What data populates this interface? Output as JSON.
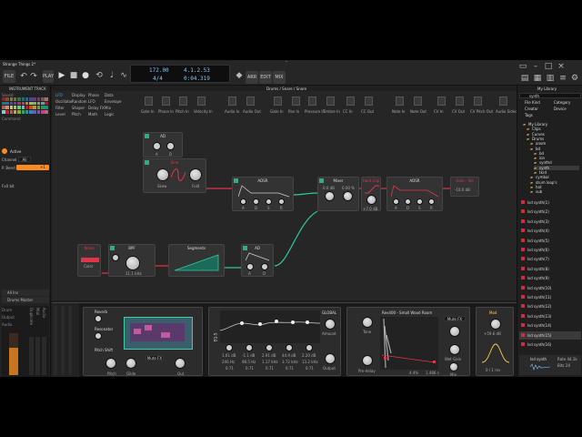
{
  "app": {
    "project_tab": "Strange Things 2*",
    "menu_label": "FILE",
    "play_label": "PLAY",
    "tempo": "172.00",
    "time_sig": "4/4",
    "position": "4.1.2.53",
    "time": "0:04.319",
    "mode_buttons": [
      "ARR",
      "EDIT",
      "MIX"
    ]
  },
  "left_panel": {
    "title": "INSTRUMENT TRACK",
    "section_sound": "Sound",
    "section_command": "Command",
    "active_label": "Active",
    "channel_label": "Channel",
    "channel_value": "All",
    "pbend_label": "P. Bend",
    "pbend_value": "+1",
    "fxslot_label": "Fx0 bit",
    "all_ins_label": "All Ins",
    "master_label": "Drums Master",
    "meter_labels": [
      "Drum",
      "Output",
      "Audio",
      "Duplicate",
      "Midi",
      "Audio"
    ]
  },
  "breadcrumb": "Drums / Snare / Snare",
  "palette": {
    "row1": [
      "LFO",
      "Display",
      "Phase",
      "Data"
    ],
    "row2": [
      "Oscillator",
      "Random",
      "LFO",
      "Envelope"
    ],
    "row3": [
      "Filter",
      "Shaper",
      "Delay FX",
      "Mix"
    ],
    "row4": [
      "Level",
      "Pitch",
      "Math",
      "Logic"
    ],
    "io_labels": [
      "Gate In",
      "Phase In",
      "Pitch In",
      "Velocity In",
      "Audio In",
      "Audio Out",
      "Gate In",
      "Pan In",
      "Pressure In",
      "Timbre In",
      "CC In",
      "CC Out",
      "Note In",
      "Note Out",
      "CV In",
      "CV Out",
      "CV Pitch Out",
      "Audio Sidechain"
    ]
  },
  "modules": {
    "ad_top": {
      "title": "AD",
      "k1": "A",
      "k2": "D"
    },
    "sine": {
      "title": "Sine",
      "k1": "Skew",
      "k2": "Fold"
    },
    "adsr": {
      "title": "ADSR",
      "labels": [
        "A",
        "D",
        "S",
        "R"
      ]
    },
    "mixer": {
      "title": "Mixer",
      "v1": "0.0 dB",
      "v2": "0.00 %"
    },
    "hardclip": {
      "title": "Hard Clip",
      "value": "+7.0 dB"
    },
    "adsr2": {
      "title": "ADSR",
      "labels": [
        "A",
        "D",
        "S",
        "R"
      ]
    },
    "gain": {
      "title": "Gain - Vol",
      "value": "-10.0 dB"
    },
    "noise": {
      "title": "Noise",
      "lbl": "Color"
    },
    "bpf": {
      "title": "BPF",
      "freq": "11.1 kHz"
    },
    "segments": {
      "title": "Segments"
    },
    "ad_bottom": {
      "title": "AD",
      "k1": "A",
      "k2": "D"
    }
  },
  "device_chain": {
    "reverb_label": "Reverb",
    "resonator_label": "Resonator",
    "pitch_shift_label": "Pitch Shift",
    "knob_labels": [
      "Pitch",
      "Glide",
      "Out"
    ],
    "mute_fx_label": "Mute FX",
    "eq_title": "EQ-5",
    "global_label": "GLOBAL",
    "eq_values": [
      "1.61 dB",
      "-1.1 dB",
      "2.91 dB",
      "44.9 dB",
      "2.20 dB"
    ],
    "eq_freqs": [
      "246 Hz",
      "98.5 Hz",
      "1.17 kHz",
      "3.72 kHz",
      "13.2 kHz"
    ],
    "eq_q": [
      "0.71",
      "0.71",
      "0.71",
      "0.71",
      "0.71"
    ],
    "amount_label": "Amount",
    "output_label": "Output",
    "convolution_title": "Rev400 - Small Wood Room",
    "tone_label": "Tone",
    "predelay_label": "Pre-delay",
    "wet_gain_label": "Wet Gain",
    "mix_label": "Mix",
    "conv_time": "4.4%",
    "conv_len": "1.486 s",
    "mute_fx2_label": "Mute FX",
    "mod_title": "Mod",
    "mod_value": "+59.6 dB",
    "mod_length": "0 / 1 ms"
  },
  "right_panel": {
    "title": "My Library",
    "search_value": "synth",
    "filter_labels": [
      "File Kind",
      "Category",
      "Creator",
      "Device",
      "Tags"
    ],
    "tree": [
      "My Library",
      "Clips",
      "Curves",
      "Drums",
      "anom",
      "bd",
      "bd",
      "ion",
      "synthd",
      "synth",
      "tkrd",
      "cymbal",
      "drum loop's",
      "hat",
      "sub"
    ],
    "results": [
      "lsd synth(1)",
      "lsd synth(2)",
      "lsd synth(3)",
      "lsd synth(4)",
      "lsd synth(5)",
      "lsd synth(6)",
      "lsd synth(7)",
      "lsd synth(8)",
      "lsd synth(9)",
      "lsd synth(10)",
      "lsd synth(11)",
      "lsd synth(12)",
      "lsd synth(13)",
      "lsd synth(14)",
      "lsd synth(15)",
      "lsd synth(16)"
    ],
    "preview_name": "lsd synth",
    "preview_meta": [
      "Rate 44.1k",
      "Bits 24"
    ]
  },
  "colors": {
    "accent_teal": "#27b08a",
    "accent_orange": "#ff8a1d",
    "cable_red": "#e0364a",
    "cable_teal": "#30c6a0",
    "lcd_blue": "#7ec8ff"
  }
}
